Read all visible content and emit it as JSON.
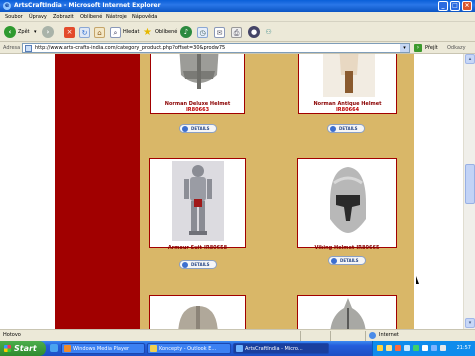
{
  "window": {
    "title": "ArtsCraftIndia - Microsoft Internet Explorer",
    "minimize": "_",
    "maximize": "□",
    "close": "×"
  },
  "menu": [
    "Soubor",
    "Úpravy",
    "Zobrazit",
    "Oblíbené",
    "Nástroje",
    "Nápověda"
  ],
  "toolbar": {
    "back_label": "Zpět",
    "search_label": "Hledat",
    "favorites_label": "Oblíbené"
  },
  "address": {
    "label": "Adresa",
    "url": "http://www.arts-crafts-india.com/category_product.php?offset=30&prodw75",
    "go_label": "Přejít",
    "links_label": "Odkazy"
  },
  "products": [
    {
      "name": "Norman Deluxe Helmet",
      "code": "IR80663",
      "details_label": "DETAILS"
    },
    {
      "name": "Norman Antique Helmet",
      "code": "IR80664",
      "details_label": "DETAILS"
    },
    {
      "name": "Armour Suit-IR80658",
      "code": "",
      "details_label": "DETAILS"
    },
    {
      "name": "Viking Helmet-IR80665",
      "code": "",
      "details_label": "DETAILS"
    }
  ],
  "status": {
    "left": "Hotovo",
    "zone": "Internet"
  },
  "taskbar": {
    "start": "Start",
    "tasks": [
      "Windows Media Player",
      "Koncepty - Outlook E...",
      "ArtsCraftIndia - Micro..."
    ],
    "clock": "21:57"
  },
  "colors": {
    "page_dark_red": "#a10000",
    "page_gold": "#d9b768",
    "title_blue": "#0a5fd8"
  }
}
